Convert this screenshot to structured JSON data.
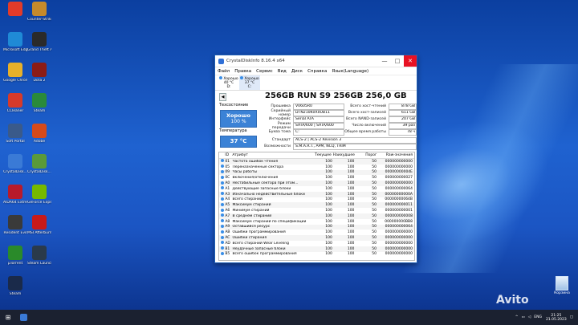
{
  "desktop": {
    "icons": [
      {
        "label": "",
        "color": "#e23b2a",
        "pos": "r0c0"
      },
      {
        "label": "Counter-Strike Global Offen...",
        "color": "#c58a2b",
        "pos": "r0c1"
      },
      {
        "label": "Microsoft Edge",
        "color": "#1f8ad6",
        "pos": "r1c0"
      },
      {
        "label": "Grand Theft Auto V",
        "color": "#2a2a2a",
        "pos": "r1c1"
      },
      {
        "label": "Google Chrome",
        "color": "#e7b02a",
        "pos": "r2c0"
      },
      {
        "label": "Dota 2",
        "color": "#8b1c16",
        "pos": "r2c1"
      },
      {
        "label": "CCleaner",
        "color": "#d63a2a",
        "pos": "r3c0"
      },
      {
        "label": "Steam",
        "color": "#2a8a3a",
        "pos": "r3c1"
      },
      {
        "label": "Soft Portal",
        "color": "#3a5a8a",
        "pos": "r4c0"
      },
      {
        "label": "Adobe",
        "color": "#d64a1a",
        "pos": "r4c1"
      },
      {
        "label": "CrystalDisk...",
        "color": "#3a7ad6",
        "pos": "r5c0"
      },
      {
        "label": "CrystalDisk...",
        "color": "#5a9a3a",
        "pos": "r5c1"
      },
      {
        "label": "AIDA64 Extreme",
        "color": "#b81a2a",
        "pos": "r6c0"
      },
      {
        "label": "GeForce Experience",
        "color": "#76b900",
        "pos": "r6c1"
      },
      {
        "label": "Resident Evil",
        "color": "#3a3a3a",
        "pos": "r7c0"
      },
      {
        "label": "MSI Afterburner",
        "color": "#c81a1a",
        "pos": "r7c1"
      },
      {
        "label": "µTorrent",
        "color": "#2a8a2a",
        "pos": "r8c0"
      },
      {
        "label": "Steam Launcher",
        "color": "#2a3a4a",
        "pos": "r8c1"
      },
      {
        "label": "Steam",
        "color": "#1a2a4a",
        "pos": "r9c0"
      }
    ],
    "recycle_bin": "Корзина",
    "watermark": "Avito"
  },
  "window": {
    "title": "CrystalDiskInfo 8.16.4 x64",
    "minimize_glyph": "—",
    "maximize_glyph": "□",
    "close_glyph": "✕",
    "menu": [
      "Файл",
      "Правка",
      "Сервис",
      "Вид",
      "Диск",
      "Справка",
      "Язык(Language)"
    ],
    "disks": [
      {
        "name": "Хорошо",
        "temp": "40 °C",
        "letter": "D:"
      },
      {
        "name": "Хорошо",
        "temp": "37 °C",
        "letter": "C:"
      }
    ],
    "model": "256GB RUN S9 256GB 256,0 GB",
    "nav_glyph": "◀",
    "status_label": "Техсостояние",
    "health_status": "Хорошо",
    "health_percent": "100 %",
    "temp_label": "Температура",
    "temperature": "37 °C",
    "fields_left": [
      {
        "label": "Прошивка",
        "value": "V0605R0"
      },
      {
        "label": "Серийный номер",
        "value": "DTN210K0X0UB11"
      },
      {
        "label": "Интерфейс",
        "value": "Serial ATA"
      },
      {
        "label": "Режим передачи",
        "value": "SATA/600 | SATA/600"
      },
      {
        "label": "Буква тома",
        "value": "C:"
      }
    ],
    "fields_right": [
      {
        "label": "Всего хост-чтений",
        "value": "878 GB"
      },
      {
        "label": "Всего хост-записей",
        "value": "611 GB"
      },
      {
        "label": "Всего NAND-записей",
        "value": "207 GB"
      },
      {
        "label": "Число включений",
        "value": "39 раз"
      },
      {
        "label": "Общее время работы",
        "value": "78 ч"
      }
    ],
    "fields_wide": [
      {
        "label": "Стандарт",
        "value": "ACS-2 | ACS-2 Revision 3"
      },
      {
        "label": "Возможности",
        "value": "S.M.A.R.T., APM, NCQ, TRIM"
      }
    ],
    "table": {
      "headers": [
        "ID",
        "Атрибут",
        "Текущее",
        "Наихудшее",
        "Порог",
        "Raw-значения"
      ],
      "rows": [
        [
          "01",
          "Частота ошибок чтения",
          "100",
          "100",
          "50",
          "000000000000"
        ],
        [
          "05",
          "Переназначенные сектора",
          "100",
          "100",
          "50",
          "000000000000"
        ],
        [
          "09",
          "Часы работы",
          "100",
          "100",
          "50",
          "00000000004E"
        ],
        [
          "0C",
          "Включения/отключения",
          "100",
          "100",
          "50",
          "000000000027"
        ],
        [
          "A0",
          "Нестабильные сектора при этом...",
          "100",
          "100",
          "50",
          "000000000000"
        ],
        [
          "A1",
          "Действующие запасные блоки",
          "100",
          "100",
          "50",
          "000000000064"
        ],
        [
          "A3",
          "Изначально недействительные блоки",
          "100",
          "100",
          "50",
          "00000000000A"
        ],
        [
          "A4",
          "Всего стираний",
          "100",
          "100",
          "50",
          "00000000064B"
        ],
        [
          "A5",
          "Максимум стираний",
          "100",
          "100",
          "50",
          "000000000011"
        ],
        [
          "A6",
          "Минимум стираний",
          "100",
          "100",
          "50",
          "000000000001"
        ],
        [
          "A7",
          "В среднем стираний",
          "100",
          "100",
          "50",
          "000000000008"
        ],
        [
          "A8",
          "Максимум стираний по спецификации",
          "100",
          "100",
          "50",
          "000000000BB8"
        ],
        [
          "A9",
          "Оставшийся ресурс",
          "100",
          "100",
          "50",
          "000000000064"
        ],
        [
          "AB",
          "Ошибки программирования",
          "100",
          "100",
          "50",
          "000000000000"
        ],
        [
          "AC",
          "Ошибки стирания",
          "100",
          "100",
          "50",
          "000000000000"
        ],
        [
          "AD",
          "Всего стираний Wear Leveling",
          "100",
          "100",
          "50",
          "000000000000"
        ],
        [
          "B1",
          "Неудачные запасные блоки",
          "100",
          "100",
          "50",
          "000000000000"
        ],
        [
          "B5",
          "Всего ошибок программирования",
          "100",
          "100",
          "50",
          "000000000000"
        ]
      ]
    }
  },
  "taskbar": {
    "start_glyph": "⊞",
    "lang": "ENG",
    "time": "21:25",
    "date": "21.05.2023"
  }
}
